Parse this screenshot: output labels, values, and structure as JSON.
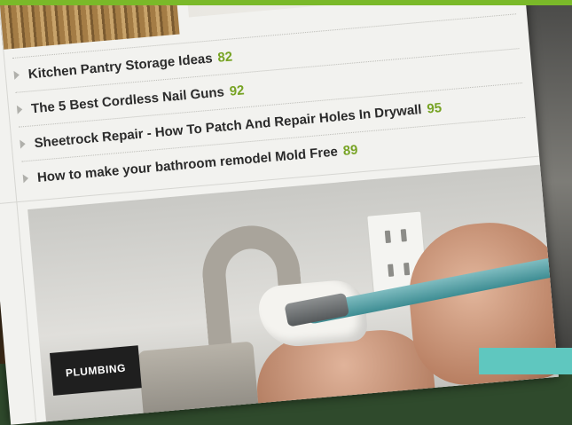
{
  "articles": [
    {
      "title": "Kitchen Pantry Storage Ideas",
      "count": "82"
    },
    {
      "title": "The 5 Best Cordless Nail Guns",
      "count": "92"
    },
    {
      "title": "Sheetrock Repair - How To Patch And Repair Holes In Drywall",
      "count": "95"
    },
    {
      "title": "How to make your bathroom remodel Mold Free",
      "count": "89"
    }
  ],
  "feature": {
    "category": "PLUMBING"
  },
  "colors": {
    "accent_green": "#7ab929",
    "count_green": "#77a324",
    "category_bg": "#1f1f1f",
    "corner_teal": "#5fc7bf"
  }
}
